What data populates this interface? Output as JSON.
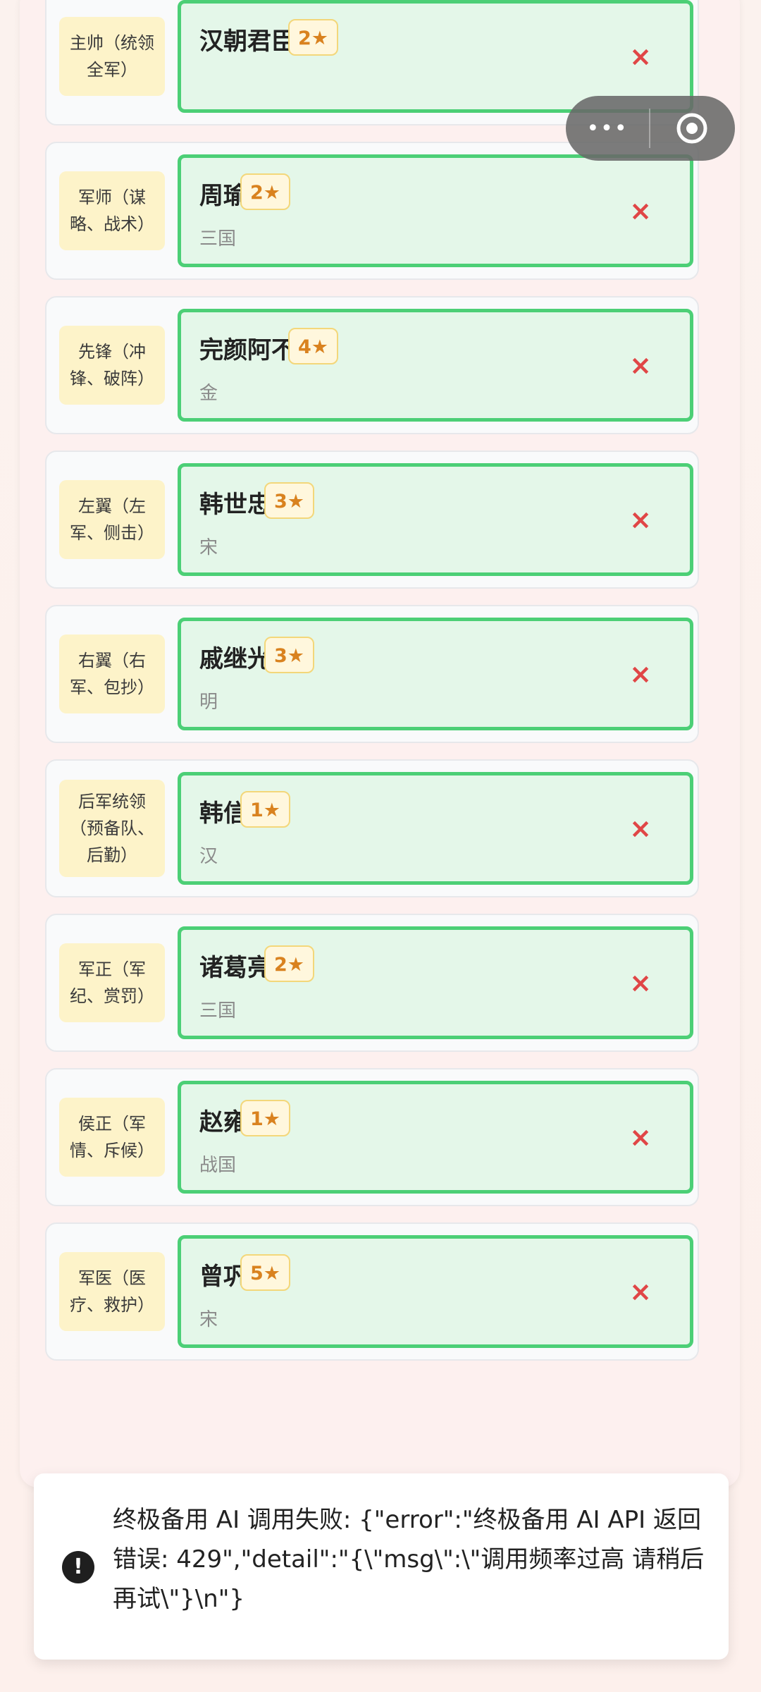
{
  "rows": [
    {
      "role": "主帅（统领全军）",
      "name": "汉朝君臣",
      "stars": "2★",
      "era": "",
      "remove": "×"
    },
    {
      "role": "军师（谋略、战术）",
      "name": "周瑜",
      "stars": "2★",
      "era": "三国",
      "remove": "×"
    },
    {
      "role": "先锋（冲锋、破阵）",
      "name": "完颜阿不",
      "stars": "4★",
      "era": "金",
      "remove": "×"
    },
    {
      "role": "左翼（左军、侧击）",
      "name": "韩世忠",
      "stars": "3★",
      "era": "宋",
      "remove": "×"
    },
    {
      "role": "右翼（右军、包抄）",
      "name": "戚继光",
      "stars": "3★",
      "era": "明",
      "remove": "×"
    },
    {
      "role": "后军统领（预备队、后勤）",
      "name": "韩信",
      "stars": "1★",
      "era": "汉",
      "remove": "×"
    },
    {
      "role": "军正（军纪、赏罚）",
      "name": "诸葛亮",
      "stars": "2★",
      "era": "三国",
      "remove": "×"
    },
    {
      "role": "侯正（军情、斥候）",
      "name": "赵雍",
      "stars": "1★",
      "era": "战国",
      "remove": "×"
    },
    {
      "role": "军医（医疗、救护）",
      "name": "曾巩",
      "stars": "5★",
      "era": "宋",
      "remove": "×"
    }
  ],
  "capsule": {
    "more": "•••"
  },
  "toast": {
    "icon": "!",
    "message": "终极备用 AI 调用失败: {\"error\":\"终极备用 AI API 返回错误: 429\",\"detail\":\"{\\\"msg\\\":\\\"调用频率过高 请稍后再试\\\"}\\n\"}"
  },
  "colors": {
    "card_border": "#4ccf76",
    "card_bg": "#e4f7e9",
    "role_bg": "#fdf3c9",
    "star_text": "#d9821f",
    "remove": "#e04646"
  }
}
